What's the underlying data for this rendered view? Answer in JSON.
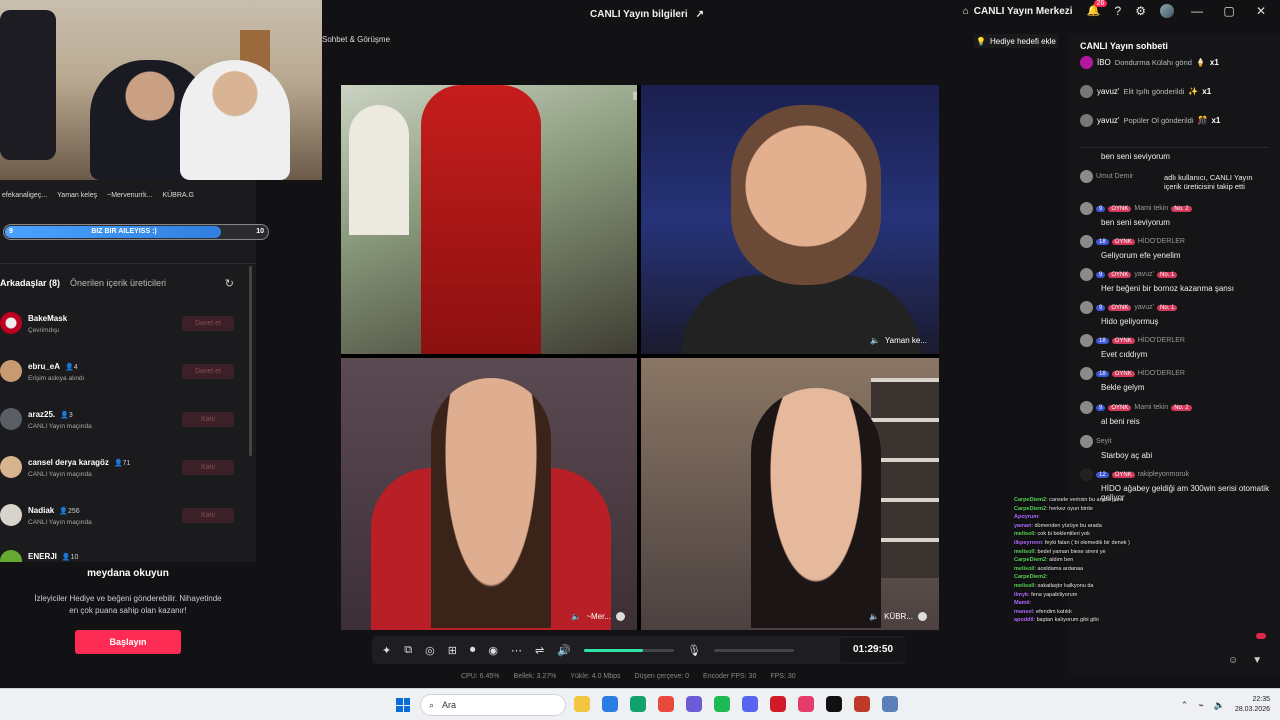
{
  "header": {
    "title": "CANLI Yayın bilgileri",
    "live_center": "CANLI Yayın Merkezi",
    "notif_count": "26",
    "window_controls": [
      "—",
      "▢",
      "✕"
    ]
  },
  "left": {
    "top_viewers": [
      "efekanaligeç...",
      "Yaman keleş",
      "~Mervenurrk...",
      "KÜBRA.G"
    ],
    "progress": {
      "left": "9",
      "label": "BIZ BIR AILEYISS :)",
      "right": "10",
      "fraction": 0.9
    },
    "tabs": {
      "friends": "Arkadaşlar (8)",
      "suggested": "Önerilen içerik üreticileri"
    },
    "friends": [
      {
        "name": "BakeMask",
        "count": "",
        "status": "Çevrimdışı",
        "button": "Davet et"
      },
      {
        "name": "ebru_eA",
        "count": "4",
        "status": "Erişim askıya alındı",
        "button": "Davet et"
      },
      {
        "name": "araz25.",
        "count": "3",
        "status": "CANLI Yayın maçında",
        "button": "Katıl"
      },
      {
        "name": "cansel derya karagöz",
        "count": "71",
        "status": "CANLI Yayın maçında",
        "button": "Katıl"
      },
      {
        "name": "Nadiak",
        "count": "256",
        "status": "CANLI Yayın maçında",
        "button": "Katıl"
      },
      {
        "name": "ENERJI",
        "count": "10",
        "status": "",
        "button": ""
      }
    ],
    "promo": {
      "title": "meydana okuyun",
      "desc": "İzleyiciler Hediye ve beğeni gönderebilir. Nihayetinde en çok puana sahip olan kazanır!",
      "button": "Başlayın"
    }
  },
  "center": {
    "chat_label": "Sohbet & Görüşme",
    "gift_goal": "Hediye hedefi ekle",
    "tiles": [
      "",
      "Yaman ke...",
      "~Mer...",
      "KÜBR..."
    ],
    "timer": "01:29:50",
    "volume_fraction": 0.66,
    "stats": [
      "CPU: 6.45%",
      "Bellek: 3.27%",
      "Yükle: 4.0 Mbps",
      "Düşen çerçeve: 0",
      "Encoder FPS: 30",
      "FPS: 30"
    ]
  },
  "chat": {
    "title": "CANLI Yayın sohbeti",
    "gifts": [
      {
        "user": "İBO",
        "text": "Dondurma Külahı gönd",
        "count": "x1"
      },
      {
        "user": "yavuz'",
        "text": "Elit Işıltı gönderildi",
        "count": "x1"
      },
      {
        "user": "yavuz'",
        "text": "Popüler Ol gönderildi",
        "count": "x1"
      }
    ],
    "messages": [
      {
        "user": "",
        "lvl": "",
        "tag": "",
        "no": "",
        "text": "ben seni seviyorum"
      },
      {
        "user": "Umut Demir",
        "lvl": "",
        "tag": "",
        "no": "",
        "text": "adlı kullanıcı, CANLI Yayın içerik üreticisini takip etti"
      },
      {
        "user": "Mami tekin",
        "lvl": "9",
        "tag": "OYNK",
        "no": "No. 2",
        "text": "ben seni seviyorum"
      },
      {
        "user": "HİDO'DERLER",
        "lvl": "18",
        "tag": "OYNK",
        "no": "",
        "text": "Geliyorum efe yenelim"
      },
      {
        "user": "yavuz'",
        "lvl": "9",
        "tag": "OYNK",
        "no": "No. 1",
        "text": "Her beğeni bir bornoz kazanma şansı"
      },
      {
        "user": "yavuz'",
        "lvl": "9",
        "tag": "OYNK",
        "no": "No. 1",
        "text": "Hido geliyormuş"
      },
      {
        "user": "HİDO'DERLER",
        "lvl": "18",
        "tag": "OYNK",
        "no": "",
        "text": "Evet cıddıym"
      },
      {
        "user": "HİDO'DERLER",
        "lvl": "18",
        "tag": "OYNK",
        "no": "",
        "text": "Bekle gelym"
      },
      {
        "user": "Mami tekin",
        "lvl": "9",
        "tag": "OYNK",
        "no": "No. 2",
        "text": "al beni reis"
      },
      {
        "user": "Seyit",
        "lvl": "",
        "tag": "",
        "no": "",
        "text": "Starboy aç abi"
      },
      {
        "user": "rakipleyonmoruk",
        "lvl": "12",
        "tag": "OYNK",
        "no": "",
        "text": "HİDO ağabey geldiği am 300win serisi otomatik geliyor"
      }
    ]
  },
  "overlay": [
    {
      "user": "CarpeDiem2",
      "text": "cansele verirsin bu arada para"
    },
    {
      "user": "CarpeDiem2",
      "text": "herkez oyun birde"
    },
    {
      "user": "Apoyrum",
      "text": ""
    },
    {
      "user": "yaman",
      "text": "dümenden yürüye bu arada"
    },
    {
      "user": "melisoll",
      "text": "cok bi beklentileri yok"
    },
    {
      "user": "ilkpeyronn",
      "text": "feyki falan ( bi olemedik bir denek )"
    },
    {
      "user": "melisoll",
      "text": "bedel yaman biese sireni ye"
    },
    {
      "user": "CarpeDiem2",
      "text": "aldım ben"
    },
    {
      "user": "melisoll",
      "text": "aoxldama ardanaa"
    },
    {
      "user": "CarpeDiem2",
      "text": ""
    },
    {
      "user": "melisoll",
      "text": "sakatlaştır kalkyonu da"
    },
    {
      "user": "ilmyk",
      "text": "fena yapabiliyorum"
    },
    {
      "user": "Mamii",
      "text": ""
    },
    {
      "user": "mansel",
      "text": "efendim katıldı"
    },
    {
      "user": "apoddil",
      "text": "baştan kalıyorum gibi gibi"
    }
  ],
  "taskbar": {
    "search": "Ara",
    "time": "22:35",
    "date": "28.03.2026",
    "apps": [
      "#f4c542",
      "#2a7de1",
      "#12a36c",
      "#e84a3c",
      "#6b5bd6",
      "#1db954",
      "#5865f2",
      "#d11a2a",
      "#e33c6d",
      "#111111",
      "#c03a2b",
      "#5b7fb8"
    ]
  }
}
